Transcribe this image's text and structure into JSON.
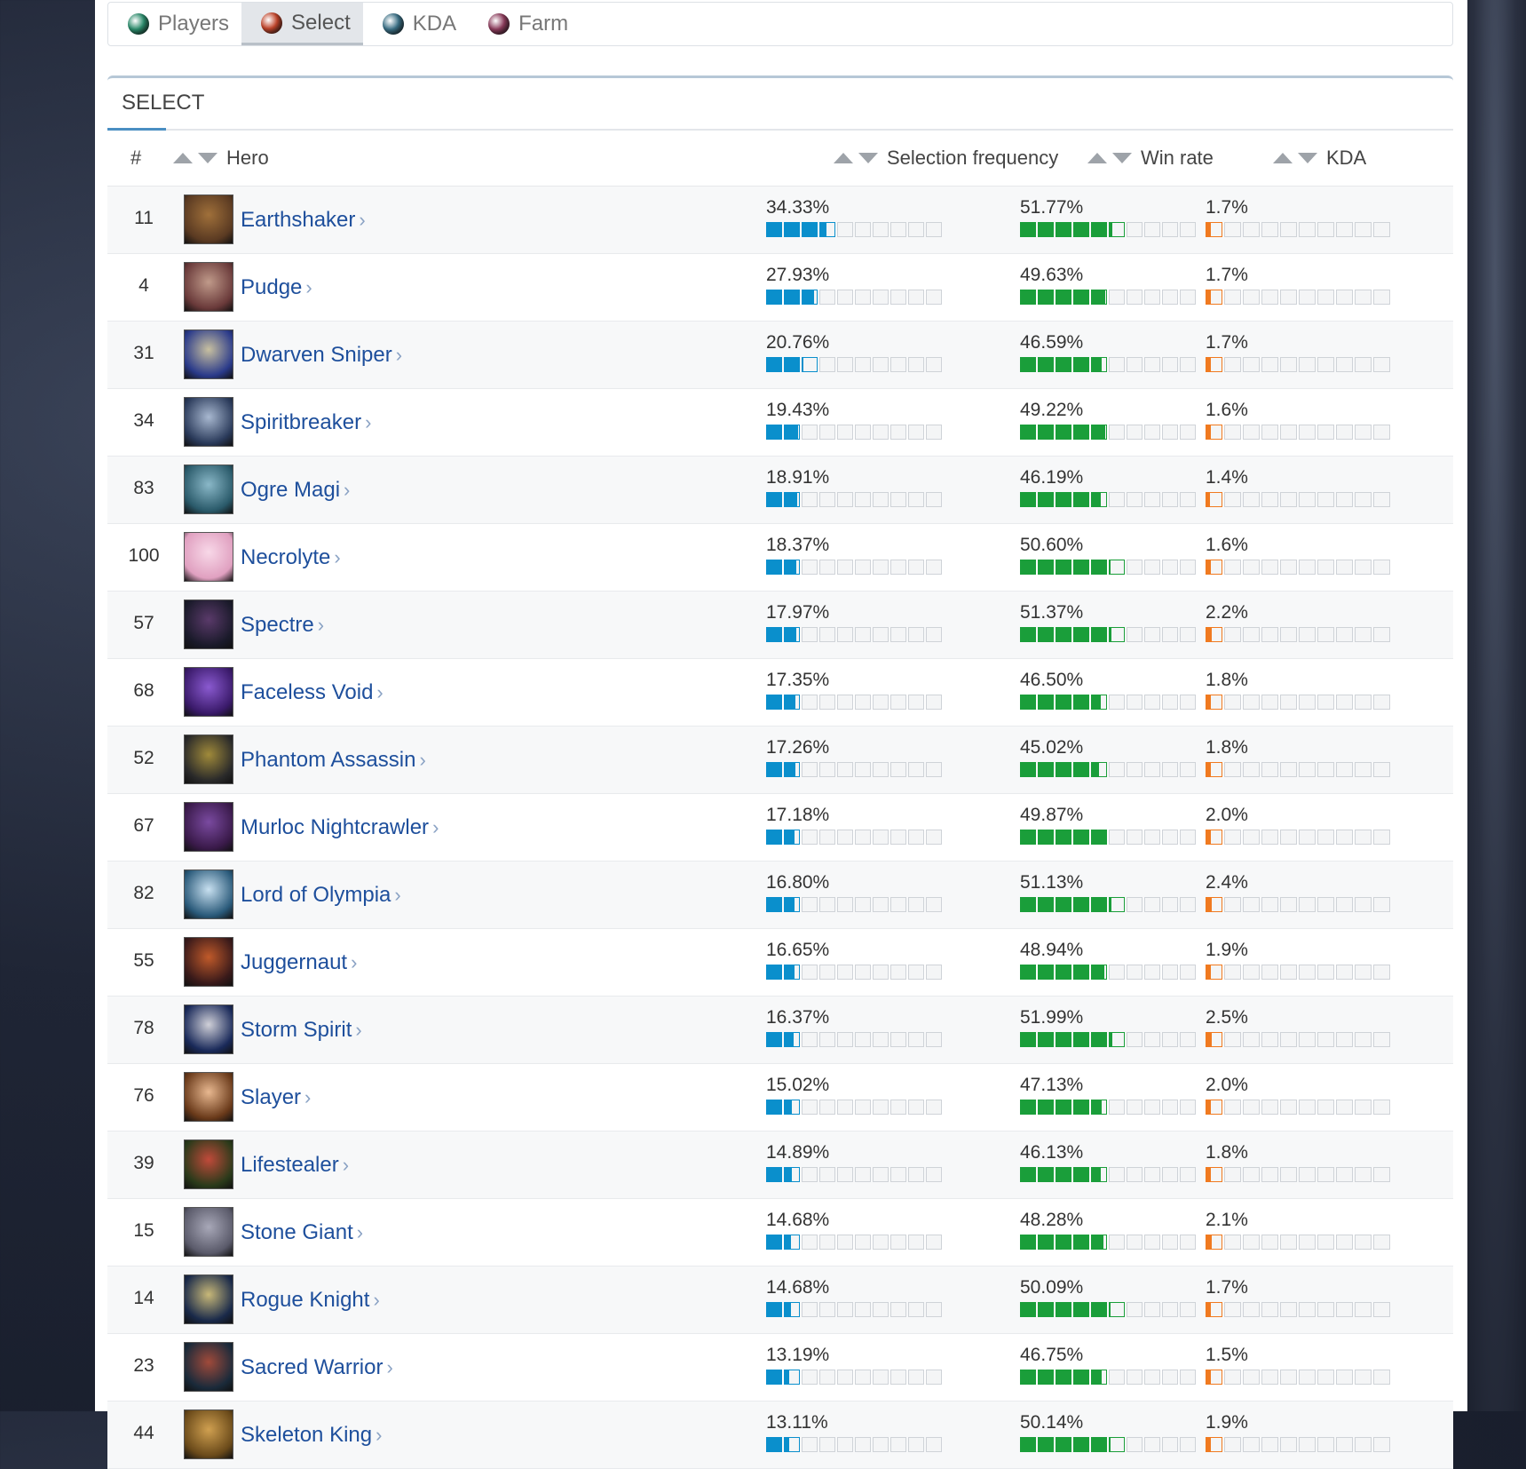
{
  "tabs": [
    {
      "label": "Players",
      "icon": "players-orb-icon",
      "color": "#2a8a6a",
      "active": false
    },
    {
      "label": "Select",
      "icon": "select-orb-icon",
      "color": "#c0442a",
      "active": true
    },
    {
      "label": "KDA",
      "icon": "kda-orb-icon",
      "color": "#3a6f85",
      "active": false
    },
    {
      "label": "Farm",
      "icon": "farm-orb-icon",
      "color": "#8a3a5a",
      "active": false
    }
  ],
  "section": {
    "title": "SELECT"
  },
  "columns": {
    "rank": "#",
    "hero": "Hero",
    "selection": "Selection frequency",
    "winrate": "Win rate",
    "kda": "KDA"
  },
  "colors": {
    "selection": "#0a8fcc",
    "winrate": "#1a9e3a",
    "kda": "#f07a20",
    "link": "#1e4f9c"
  },
  "rows": [
    {
      "rank": "11",
      "hero": "Earthshaker",
      "sel": "34.33%",
      "sel_v": 34.33,
      "win": "51.77%",
      "win_v": 51.77,
      "kda": "1.7%",
      "kda_v": 1.7,
      "img": [
        "#5a3a22",
        "#a0703a"
      ]
    },
    {
      "rank": "4",
      "hero": "Pudge",
      "sel": "27.93%",
      "sel_v": 27.93,
      "win": "49.63%",
      "win_v": 49.63,
      "kda": "1.7%",
      "kda_v": 1.7,
      "img": [
        "#6a3a3a",
        "#c09a8a"
      ]
    },
    {
      "rank": "31",
      "hero": "Dwarven Sniper",
      "sel": "20.76%",
      "sel_v": 20.76,
      "win": "46.59%",
      "win_v": 46.59,
      "kda": "1.7%",
      "kda_v": 1.7,
      "img": [
        "#2a3a8a",
        "#c8c0a0"
      ]
    },
    {
      "rank": "34",
      "hero": "Spiritbreaker",
      "sel": "19.43%",
      "sel_v": 19.43,
      "win": "49.22%",
      "win_v": 49.22,
      "kda": "1.6%",
      "kda_v": 1.6,
      "img": [
        "#2a3a5a",
        "#a8b8d0"
      ]
    },
    {
      "rank": "83",
      "hero": "Ogre Magi",
      "sel": "18.91%",
      "sel_v": 18.91,
      "win": "46.19%",
      "win_v": 46.19,
      "kda": "1.4%",
      "kda_v": 1.4,
      "img": [
        "#2a5a6a",
        "#8ab8c8"
      ]
    },
    {
      "rank": "100",
      "hero": "Necrolyte",
      "sel": "18.37%",
      "sel_v": 18.37,
      "win": "50.60%",
      "win_v": 50.6,
      "kda": "1.6%",
      "kda_v": 1.6,
      "img": [
        "#e0a0c0",
        "#f8d8e8"
      ]
    },
    {
      "rank": "57",
      "hero": "Spectre",
      "sel": "17.97%",
      "sel_v": 17.97,
      "win": "51.37%",
      "win_v": 51.37,
      "kda": "2.2%",
      "kda_v": 2.2,
      "img": [
        "#1a1a2a",
        "#5a3a6a"
      ]
    },
    {
      "rank": "68",
      "hero": "Faceless Void",
      "sel": "17.35%",
      "sel_v": 17.35,
      "win": "46.50%",
      "win_v": 46.5,
      "kda": "1.8%",
      "kda_v": 1.8,
      "img": [
        "#3a1a6a",
        "#8a5ad0"
      ]
    },
    {
      "rank": "52",
      "hero": "Phantom Assassin",
      "sel": "17.26%",
      "sel_v": 17.26,
      "win": "45.02%",
      "win_v": 45.02,
      "kda": "1.8%",
      "kda_v": 1.8,
      "img": [
        "#2a2a2a",
        "#a08a3a"
      ]
    },
    {
      "rank": "67",
      "hero": "Murloc Nightcrawler",
      "sel": "17.18%",
      "sel_v": 17.18,
      "win": "49.87%",
      "win_v": 49.87,
      "kda": "2.0%",
      "kda_v": 2.0,
      "img": [
        "#3a1a4a",
        "#7a4aa0"
      ]
    },
    {
      "rank": "82",
      "hero": "Lord of Olympia",
      "sel": "16.80%",
      "sel_v": 16.8,
      "win": "51.13%",
      "win_v": 51.13,
      "kda": "2.4%",
      "kda_v": 2.4,
      "img": [
        "#2a5a7a",
        "#c8e0f0"
      ]
    },
    {
      "rank": "55",
      "hero": "Juggernaut",
      "sel": "16.65%",
      "sel_v": 16.65,
      "win": "48.94%",
      "win_v": 48.94,
      "kda": "1.9%",
      "kda_v": 1.9,
      "img": [
        "#3a1a1a",
        "#c05a2a"
      ]
    },
    {
      "rank": "78",
      "hero": "Storm Spirit",
      "sel": "16.37%",
      "sel_v": 16.37,
      "win": "51.99%",
      "win_v": 51.99,
      "kda": "2.5%",
      "kda_v": 2.5,
      "img": [
        "#1a2a5a",
        "#d0d0d8"
      ]
    },
    {
      "rank": "76",
      "hero": "Slayer",
      "sel": "15.02%",
      "sel_v": 15.02,
      "win": "47.13%",
      "win_v": 47.13,
      "kda": "2.0%",
      "kda_v": 2.0,
      "img": [
        "#6a3a1a",
        "#e8b890"
      ]
    },
    {
      "rank": "39",
      "hero": "Lifestealer",
      "sel": "14.89%",
      "sel_v": 14.89,
      "win": "46.13%",
      "win_v": 46.13,
      "kda": "1.8%",
      "kda_v": 1.8,
      "img": [
        "#2a3a1a",
        "#c04a3a"
      ]
    },
    {
      "rank": "15",
      "hero": "Stone Giant",
      "sel": "14.68%",
      "sel_v": 14.68,
      "win": "48.28%",
      "win_v": 48.28,
      "kda": "2.1%",
      "kda_v": 2.1,
      "img": [
        "#5a5a6a",
        "#a8a8b8"
      ]
    },
    {
      "rank": "14",
      "hero": "Rogue Knight",
      "sel": "14.68%",
      "sel_v": 14.68,
      "win": "50.09%",
      "win_v": 50.09,
      "kda": "1.7%",
      "kda_v": 1.7,
      "img": [
        "#1a2a4a",
        "#c8b878"
      ]
    },
    {
      "rank": "23",
      "hero": "Sacred Warrior",
      "sel": "13.19%",
      "sel_v": 13.19,
      "win": "46.75%",
      "win_v": 46.75,
      "kda": "1.5%",
      "kda_v": 1.5,
      "img": [
        "#1a2a3a",
        "#a04a3a"
      ]
    },
    {
      "rank": "44",
      "hero": "Skeleton King",
      "sel": "13.11%",
      "sel_v": 13.11,
      "win": "50.14%",
      "win_v": 50.14,
      "kda": "1.9%",
      "kda_v": 1.9,
      "img": [
        "#6a4a1a",
        "#d0a050"
      ]
    }
  ]
}
